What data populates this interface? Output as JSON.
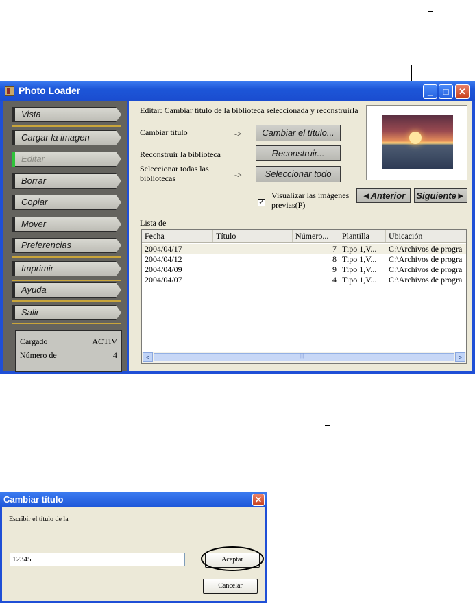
{
  "window": {
    "title": "Photo Loader",
    "controls": {
      "minimize": "_",
      "maximize": "□",
      "close": "✕"
    }
  },
  "sidebar": {
    "items": [
      {
        "label": "Vista"
      },
      {
        "label": "Cargar la imagen"
      },
      {
        "label": "Editar",
        "disabled": true
      },
      {
        "label": "Borrar"
      },
      {
        "label": "Copiar"
      },
      {
        "label": "Mover"
      },
      {
        "label": "Preferencias"
      },
      {
        "label": "Imprimir"
      },
      {
        "label": "Ayuda"
      },
      {
        "label": "Salir"
      }
    ],
    "status": {
      "loaded_label": "Cargado",
      "loaded_value": "ACTIV",
      "count_label": "Número de",
      "count_value": "4"
    }
  },
  "edit_panel": {
    "heading": "Editar: Cambiar título de la biblioteca seleccionada y reconstruirla",
    "change_title_label": "Cambiar título",
    "change_title_arrow": "->",
    "change_title_button": "Cambiar el título...",
    "rebuild_label": "Reconstruir la biblioteca",
    "rebuild_button": "Reconstruir...",
    "select_all_label": "Seleccionar todas las bibliotecas",
    "select_all_arrow": "->",
    "select_all_button": "Seleccionar todo",
    "preview_checkbox_label": "Visualizar las imágenes previas(P)",
    "preview_checked": true,
    "prev_button": "◄Anterior",
    "next_button": "Siguiente►"
  },
  "library_list": {
    "label": "Lista de",
    "columns": [
      "Fecha",
      "Título",
      "Número...",
      "Plantilla",
      "Ubicación"
    ],
    "rows": [
      {
        "fecha": "2004/04/17",
        "titulo": "",
        "numero": "7",
        "plantilla": "Tipo 1,V...",
        "ubicacion": "C:\\Archivos de progra"
      },
      {
        "fecha": "2004/04/12",
        "titulo": "",
        "numero": "8",
        "plantilla": "Tipo 1,V...",
        "ubicacion": "C:\\Archivos de progra"
      },
      {
        "fecha": "2004/04/09",
        "titulo": "",
        "numero": "9",
        "plantilla": "Tipo 1,V...",
        "ubicacion": "C:\\Archivos de progra"
      },
      {
        "fecha": "2004/04/07",
        "titulo": "",
        "numero": "4",
        "plantilla": "Tipo 1,V...",
        "ubicacion": "C:\\Archivos de progra"
      }
    ],
    "scroll_left": "<",
    "scroll_right": ">",
    "scroll_grip": "|||"
  },
  "dialog": {
    "title": "Cambiar título",
    "close": "✕",
    "prompt": "Escribir el título de la",
    "input_value": "12345",
    "ok_button": "Aceptar",
    "cancel_button": "Cancelar"
  }
}
